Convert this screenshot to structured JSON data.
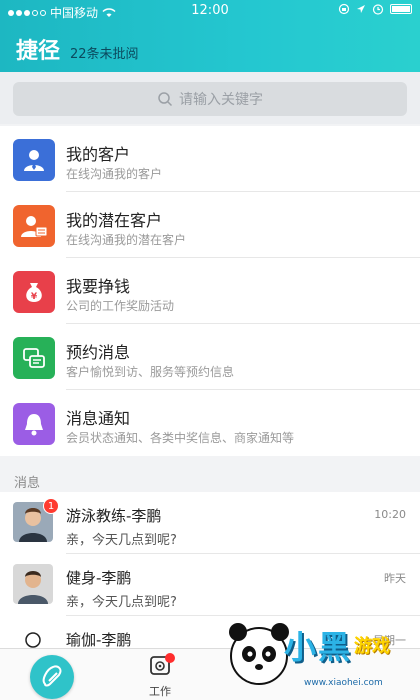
{
  "status_bar": {
    "carrier": "中国移动",
    "time": "12:00"
  },
  "header": {
    "title": "捷径",
    "unread": "22条未批阅"
  },
  "search": {
    "placeholder": "请输入关键字"
  },
  "menu": [
    {
      "title": "我的客户",
      "subtitle": "在线沟通我的客户",
      "icon": "person-icon",
      "color": "#3b6fd8"
    },
    {
      "title": "我的潜在客户",
      "subtitle": "在线沟通我的潜在客户",
      "icon": "person-card-icon",
      "color": "#f0642e"
    },
    {
      "title": "我要挣钱",
      "subtitle": "公司的工作奖励活动",
      "icon": "money-bag-icon",
      "color": "#e8404a"
    },
    {
      "title": "预约消息",
      "subtitle": "客户愉悦到访、服务等预约信息",
      "icon": "chat-icon",
      "color": "#27b158"
    },
    {
      "title": "消息通知",
      "subtitle": "会员状态通知、各类中奖信息、商家通知等",
      "icon": "bell-icon",
      "color": "#9b5de5"
    }
  ],
  "section_label": "消息",
  "messages": [
    {
      "name": "游泳教练-李鹏",
      "preview": "亲，今天几点到呢?",
      "time": "10:20",
      "badge": "1"
    },
    {
      "name": "健身-李鹏",
      "preview": "亲，今天几点到呢?",
      "time": "昨天"
    },
    {
      "name": "瑜伽-李鹏",
      "preview": "",
      "time": "星期一"
    }
  ],
  "tabbar": {
    "work_label": "工作"
  },
  "watermark": {
    "text": "小黑",
    "sub": "游戏",
    "url": "www.xiaohei.com"
  }
}
